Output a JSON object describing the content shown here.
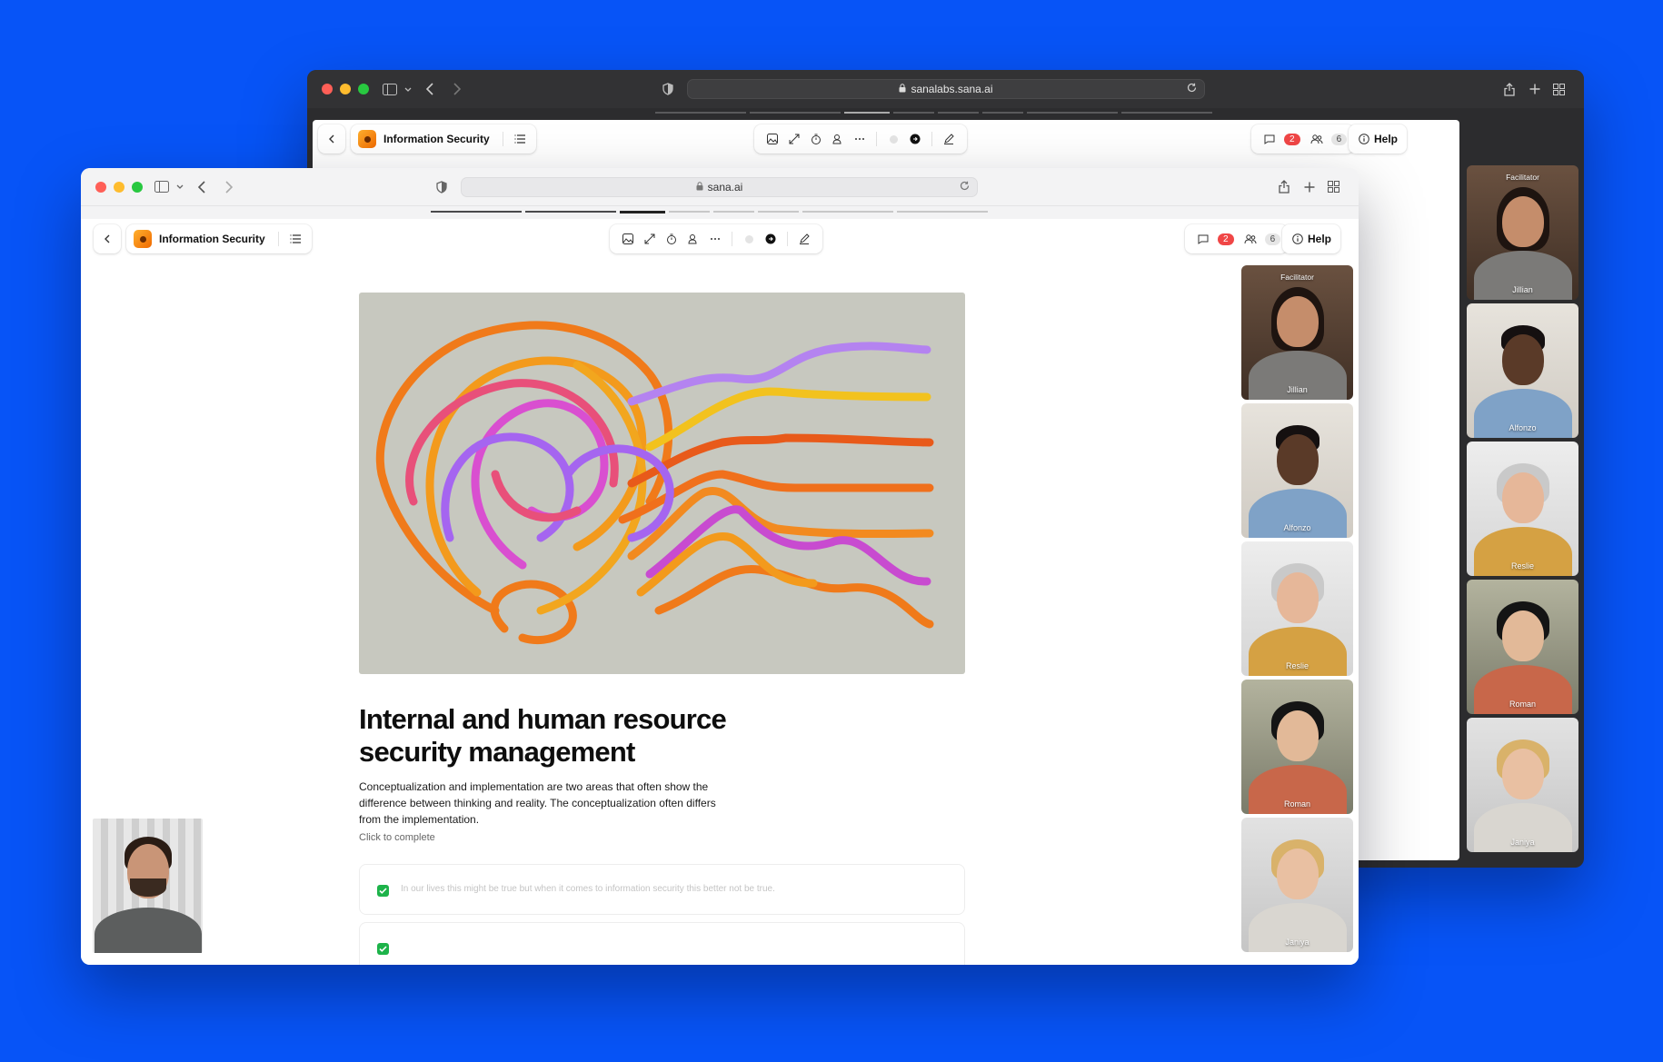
{
  "back_window": {
    "url": "sanalabs.sana.ai",
    "app_title": "Information Security",
    "comment_count": "2",
    "people_count": "6",
    "help_label": "Help"
  },
  "front_window": {
    "url": "sana.ai",
    "app_title": "Information Security",
    "comment_count": "2",
    "people_count": "6",
    "help_label": "Help"
  },
  "lesson": {
    "title": "Internal and human resource security management",
    "description": "Conceptualization and implementation are two areas that often show the difference between thinking and reality. The conceptualization often differs from the implementation.",
    "click_to_complete": "Click to complete",
    "options": [
      "In our lives this might be true but when it comes to information security this better not be true."
    ]
  },
  "participants": [
    {
      "name": "Jillian",
      "role": "Facilitator"
    },
    {
      "name": "Alfonzo",
      "role": ""
    },
    {
      "name": "Reslie",
      "role": ""
    },
    {
      "name": "Roman",
      "role": ""
    },
    {
      "name": "Janiya",
      "role": ""
    }
  ],
  "icons": [
    "back-chevron-icon",
    "outline-icon",
    "image-icon",
    "layout-icon",
    "timer-icon",
    "people-add-icon",
    "more-icon",
    "circle-icon",
    "arrow-right-circle-icon",
    "pen-icon",
    "comment-icon",
    "people-icon",
    "info-icon",
    "sidebar-icon",
    "share-icon",
    "plus-icon",
    "grid-icon",
    "lock-icon",
    "reload-icon",
    "shield-icon"
  ],
  "colors": {
    "background": "#0754F7",
    "badge_red": "#F04646",
    "check_green": "#1DB34A",
    "brand_orange": "#F59300"
  }
}
